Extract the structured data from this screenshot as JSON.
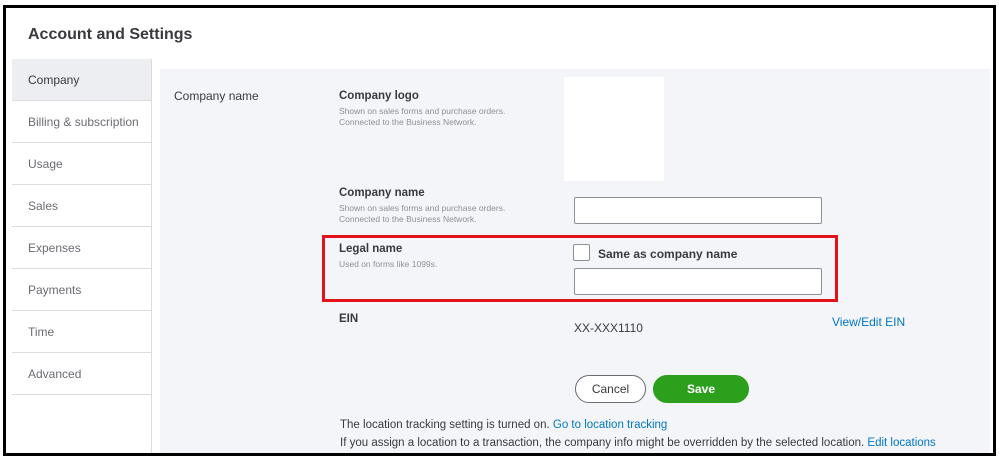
{
  "page": {
    "title": "Account and Settings"
  },
  "sidebar": {
    "items": [
      {
        "label": "Company",
        "active": true
      },
      {
        "label": "Billing & subscription",
        "active": false
      },
      {
        "label": "Usage",
        "active": false
      },
      {
        "label": "Sales",
        "active": false
      },
      {
        "label": "Expenses",
        "active": false
      },
      {
        "label": "Payments",
        "active": false
      },
      {
        "label": "Time",
        "active": false
      },
      {
        "label": "Advanced",
        "active": false
      }
    ]
  },
  "company_section": {
    "label": "Company name",
    "company_logo": {
      "title": "Company logo",
      "help_line1": "Shown on sales forms and purchase orders.",
      "help_line2": "Connected to the Business Network."
    },
    "company_name": {
      "title": "Company name",
      "help_line1": "Shown on sales forms and purchase orders.",
      "help_line2": "Connected to the Business Network.",
      "value": ""
    },
    "legal_name": {
      "title": "Legal name",
      "help": "Used on forms like 1099s.",
      "checkbox_label": "Same as company name",
      "checked": false,
      "value": ""
    },
    "ein": {
      "title": "EIN",
      "value": "XX-XXX1110",
      "link": "View/Edit EIN"
    },
    "buttons": {
      "cancel": "Cancel",
      "save": "Save"
    },
    "footer": {
      "line1_text": "The location tracking setting is turned on.",
      "line1_link": "Go to location tracking",
      "line2_text": "If you assign a location to a transaction, the company info might be overridden by the selected location.",
      "line2_link": "Edit locations"
    }
  },
  "colors": {
    "accent_link": "#0077c5",
    "save_green": "#2ca01c",
    "highlight_red": "#e2121b",
    "panel_bg": "#f4f5f8"
  }
}
